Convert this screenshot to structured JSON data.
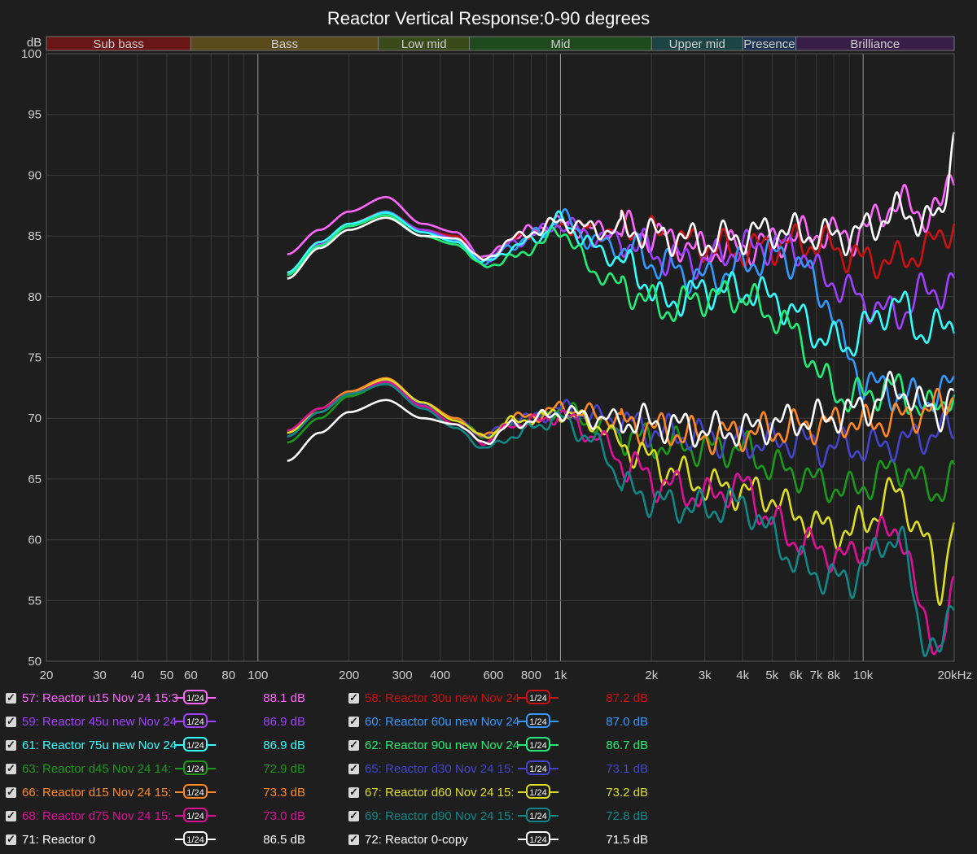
{
  "chart_data": {
    "type": "line",
    "title": "Reactor Vertical Response:0-90 degrees",
    "ylabel": "dB",
    "xlabel": "",
    "x_scale": "log",
    "xlim": [
      20,
      20000
    ],
    "ylim": [
      50,
      100
    ],
    "grid": true,
    "x_ticks": [
      {
        "value": 20,
        "label": "20"
      },
      {
        "value": 30,
        "label": "30"
      },
      {
        "value": 40,
        "label": "40"
      },
      {
        "value": 50,
        "label": "50"
      },
      {
        "value": 60,
        "label": "60"
      },
      {
        "value": 80,
        "label": "80"
      },
      {
        "value": 100,
        "label": "100"
      },
      {
        "value": 200,
        "label": "200"
      },
      {
        "value": 300,
        "label": "300"
      },
      {
        "value": 400,
        "label": "400"
      },
      {
        "value": 600,
        "label": "600"
      },
      {
        "value": 800,
        "label": "800"
      },
      {
        "value": 1000,
        "label": "1k"
      },
      {
        "value": 2000,
        "label": "2k"
      },
      {
        "value": 3000,
        "label": "3k"
      },
      {
        "value": 4000,
        "label": "4k"
      },
      {
        "value": 5000,
        "label": "5k"
      },
      {
        "value": 6000,
        "label": "6k"
      },
      {
        "value": 7000,
        "label": "7k"
      },
      {
        "value": 8000,
        "label": "8k"
      },
      {
        "value": 10000,
        "label": "10k"
      },
      {
        "value": 20000,
        "label": "20kHz"
      }
    ],
    "y_ticks": [
      {
        "value": 100,
        "label": "100"
      },
      {
        "value": 95,
        "label": "95"
      },
      {
        "value": 90,
        "label": "90"
      },
      {
        "value": 85,
        "label": "85"
      },
      {
        "value": 80,
        "label": "80"
      },
      {
        "value": 75,
        "label": "75"
      },
      {
        "value": 70,
        "label": "70"
      },
      {
        "value": 65,
        "label": "65"
      },
      {
        "value": 60,
        "label": "60"
      },
      {
        "value": 55,
        "label": "55"
      },
      {
        "value": 50,
        "label": "50"
      }
    ],
    "bands": [
      {
        "name": "Sub bass",
        "from": 20,
        "to": 60,
        "color": "#6b1616"
      },
      {
        "name": "Bass",
        "from": 60,
        "to": 250,
        "color": "#5a4a1c"
      },
      {
        "name": "Low mid",
        "from": 250,
        "to": 500,
        "color": "#3a4a18"
      },
      {
        "name": "Mid",
        "from": 500,
        "to": 2000,
        "color": "#1e4a1e"
      },
      {
        "name": "Upper mid",
        "from": 2000,
        "to": 4000,
        "color": "#1c4444"
      },
      {
        "name": "Presence",
        "from": 4000,
        "to": 6000,
        "color": "#1e3450"
      },
      {
        "name": "Brilliance",
        "from": 6000,
        "to": 20000,
        "color": "#3a1e4a"
      }
    ],
    "x": [
      125,
      160,
      200,
      265,
      350,
      450,
      560,
      700,
      850,
      1000,
      1300,
      1700,
      2200,
      3000,
      4000,
      5000,
      6000,
      7500,
      9000,
      10000,
      13000,
      16000,
      18000,
      20000
    ],
    "series": [
      {
        "name": "57: Reactor u15 Nov 24 15:3",
        "color": "#ff66ff",
        "level": "88.1 dB",
        "values": [
          83.5,
          85.5,
          87.0,
          88.2,
          86.0,
          85.3,
          83.2,
          84.8,
          85.8,
          86.0,
          85.5,
          85.5,
          84.8,
          83.8,
          84.0,
          84.5,
          85.0,
          85.3,
          84.8,
          85.6,
          87.8,
          86.8,
          87.2,
          90.5
        ]
      },
      {
        "name": "58: Reactor 30u new Nov 24",
        "color": "#cc1111",
        "level": "87.2 dB",
        "values": [
          82.0,
          84.5,
          86.0,
          87.0,
          85.5,
          85.0,
          83.0,
          84.6,
          85.5,
          86.0,
          85.4,
          85.6,
          85.0,
          84.2,
          83.8,
          84.2,
          84.5,
          84.3,
          83.5,
          83.0,
          83.0,
          83.8,
          85.0,
          86.0
        ]
      },
      {
        "name": "59: Reactor 45u new Nov 24",
        "color": "#a040ff",
        "level": "86.9 dB",
        "values": [
          82.0,
          84.3,
          85.8,
          86.9,
          85.5,
          84.8,
          83.0,
          84.4,
          85.3,
          86.0,
          85.0,
          84.5,
          83.2,
          83.0,
          84.0,
          84.2,
          84.0,
          81.5,
          80.5,
          79.5,
          78.5,
          80.5,
          80.5,
          81.0
        ]
      },
      {
        "name": "60: Reactor 60u new Nov 24",
        "color": "#3399ff",
        "level": "87.0 dB",
        "values": [
          81.8,
          84.2,
          85.8,
          87.0,
          85.3,
          84.7,
          82.8,
          84.3,
          85.2,
          86.5,
          84.5,
          83.8,
          82.5,
          81.5,
          82.5,
          83.5,
          83.0,
          80.0,
          75.0,
          73.0,
          72.0,
          71.5,
          72.0,
          73.0
        ]
      },
      {
        "name": "61: Reactor 75u new Nov 24",
        "color": "#33ffff",
        "level": "86.9 dB",
        "values": [
          82.0,
          84.5,
          86.0,
          86.9,
          85.3,
          84.5,
          82.8,
          84.0,
          85.0,
          86.3,
          84.0,
          82.5,
          79.5,
          80.5,
          80.5,
          80.0,
          78.5,
          76.5,
          76.0,
          77.5,
          79.5,
          77.0,
          77.5,
          78.0
        ]
      },
      {
        "name": "62: Reactor 90u new Nov 24",
        "color": "#22ee77",
        "level": "86.7 dB",
        "values": [
          81.8,
          84.2,
          85.8,
          86.7,
          85.0,
          84.3,
          82.5,
          83.2,
          84.3,
          85.5,
          82.0,
          80.5,
          79.0,
          80.0,
          80.0,
          78.5,
          77.0,
          73.0,
          71.5,
          72.0,
          72.5,
          70.5,
          71.5,
          72.0
        ]
      },
      {
        "name": "63: Reactor d45 Nov 24 14:",
        "color": "#1a9a1a",
        "level": "72.9 dB",
        "values": [
          68.0,
          70.0,
          71.8,
          72.9,
          71.0,
          70.0,
          68.5,
          69.5,
          70.0,
          70.8,
          69.5,
          68.5,
          67.8,
          67.5,
          67.5,
          66.0,
          65.5,
          64.5,
          64.0,
          64.5,
          66.0,
          64.5,
          64.0,
          65.0
        ]
      },
      {
        "name": "65: Reactor d30 Nov 24 15:",
        "color": "#4444cc",
        "level": "73.1 dB",
        "values": [
          68.5,
          70.5,
          72.0,
          73.1,
          71.2,
          70.0,
          68.5,
          69.8,
          70.2,
          70.8,
          70.2,
          69.5,
          68.8,
          68.5,
          68.0,
          68.0,
          68.2,
          67.5,
          67.8,
          67.5,
          68.0,
          68.5,
          69.0,
          69.0
        ]
      },
      {
        "name": "66: Reactor d15 Nov 24 15:",
        "color": "#ff8822",
        "level": "73.3 dB",
        "values": [
          68.8,
          70.8,
          72.2,
          73.3,
          71.3,
          70.0,
          68.5,
          70.0,
          70.3,
          70.8,
          70.3,
          69.5,
          69.0,
          68.5,
          68.8,
          69.0,
          69.3,
          69.5,
          69.8,
          69.5,
          70.0,
          70.5,
          71.0,
          72.0
        ]
      },
      {
        "name": "67: Reactor d60 Nov 24 15:",
        "color": "#dddd22",
        "level": "73.2 dB",
        "values": [
          68.8,
          70.5,
          72.0,
          73.2,
          71.3,
          69.8,
          68.5,
          69.8,
          70.0,
          70.5,
          69.5,
          67.5,
          66.0,
          64.5,
          64.0,
          63.5,
          62.0,
          61.0,
          60.5,
          61.5,
          64.0,
          60.0,
          56.0,
          61.5
        ]
      },
      {
        "name": "68: Reactor d75 Nov 24 15:",
        "color": "#dd1199",
        "level": "73.0 dB",
        "values": [
          69.0,
          70.8,
          72.0,
          73.0,
          71.0,
          69.5,
          68.0,
          69.5,
          69.8,
          70.3,
          68.5,
          66.0,
          64.5,
          63.5,
          64.5,
          61.5,
          60.0,
          59.0,
          58.5,
          59.5,
          61.0,
          53.5,
          51.0,
          55.5
        ]
      },
      {
        "name": "69: Reactor d90 Nov 24 15:",
        "color": "#118888",
        "level": "72.8 dB",
        "values": [
          68.5,
          70.5,
          72.0,
          72.8,
          70.8,
          69.2,
          67.5,
          68.5,
          69.5,
          70.0,
          68.0,
          64.0,
          63.0,
          62.5,
          63.0,
          60.5,
          58.0,
          57.0,
          56.5,
          58.0,
          60.5,
          52.0,
          50.5,
          55.5
        ]
      },
      {
        "name": "71: Reactor 0",
        "color": "#ffffff",
        "level": "86.5 dB",
        "values": [
          81.5,
          84.0,
          85.5,
          86.5,
          85.0,
          84.8,
          83.0,
          84.8,
          85.5,
          86.2,
          85.5,
          85.5,
          85.0,
          84.5,
          85.0,
          85.5,
          85.3,
          85.0,
          85.0,
          85.5,
          87.0,
          86.3,
          86.5,
          93.5
        ]
      },
      {
        "name": "72: Reactor 0-copy",
        "color": "#ffffff",
        "level": "71.5 dB",
        "values": [
          66.5,
          68.8,
          70.5,
          71.5,
          70.0,
          69.5,
          68.0,
          69.5,
          70.0,
          70.5,
          70.0,
          69.8,
          69.5,
          69.0,
          69.0,
          69.5,
          69.8,
          70.0,
          70.5,
          70.8,
          72.5,
          71.0,
          70.5,
          72.0
        ]
      }
    ]
  },
  "legend": {
    "smoothing_label": "1/24"
  }
}
